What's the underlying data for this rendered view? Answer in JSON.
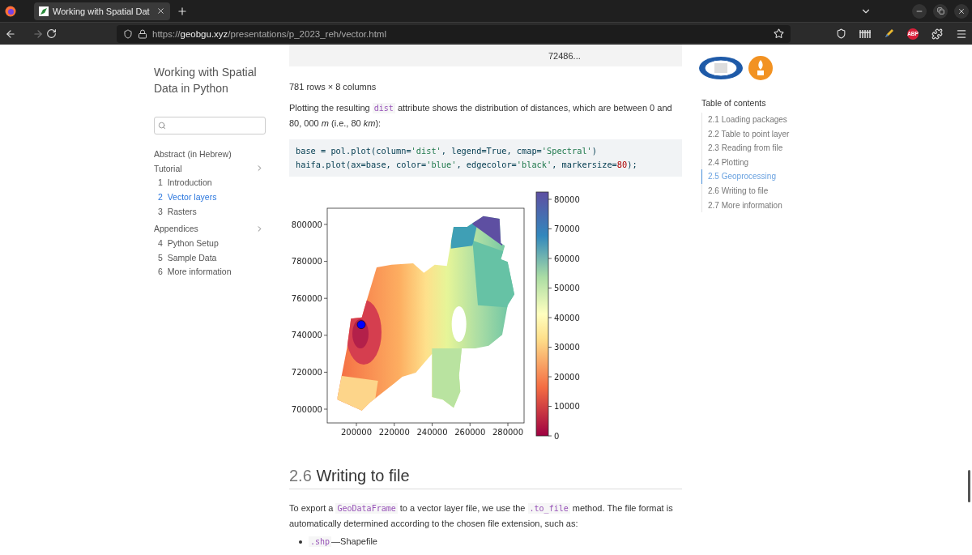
{
  "browser": {
    "tab_title": "Working with Spatial Dat",
    "url_scheme": "https://",
    "url_host": "geobgu.xyz",
    "url_path": "/presentations/p_2023_reh/vector.html",
    "extension_badge": "ABP"
  },
  "sidebar": {
    "title": "Working with Spatial Data in Python",
    "items": [
      {
        "kind": "link",
        "label": "Abstract (in Hebrew)"
      },
      {
        "kind": "section",
        "label": "Tutorial",
        "children": [
          {
            "number": "1",
            "label": "Introduction",
            "selected": false
          },
          {
            "number": "2",
            "label": "Vector layers",
            "selected": true
          },
          {
            "number": "3",
            "label": "Rasters",
            "selected": false
          }
        ]
      },
      {
        "kind": "section",
        "label": "Appendices",
        "children": [
          {
            "number": "4",
            "label": "Python Setup",
            "selected": false
          },
          {
            "number": "5",
            "label": "Sample Data",
            "selected": false
          },
          {
            "number": "6",
            "label": "More information",
            "selected": false
          }
        ]
      }
    ]
  },
  "main": {
    "table_tail": "72486...",
    "table_shape": "781 rows × 8 columns",
    "paragraph": [
      {
        "kind": "text",
        "text": "Plotting the resulting "
      },
      {
        "kind": "code",
        "text": "dist"
      },
      {
        "kind": "text",
        "text": " attribute shows the distribution of distances, which are between 0 and 80, 000 *m* (i.e., 80 *km*):"
      }
    ],
    "code_lines": [
      [
        {
          "kind": "plain",
          "text": "base = pol.plot(column="
        },
        {
          "kind": "string",
          "text": "'dist'"
        },
        {
          "kind": "plain",
          "text": ", legend=True, cmap="
        },
        {
          "kind": "string",
          "text": "'Spectral'"
        },
        {
          "kind": "plain",
          "text": ")"
        }
      ],
      [
        {
          "kind": "plain",
          "text": "haifa.plot(ax=base, color="
        },
        {
          "kind": "string",
          "text": "'blue'"
        },
        {
          "kind": "plain",
          "text": ", edgecolor="
        },
        {
          "kind": "string",
          "text": "'black'"
        },
        {
          "kind": "plain",
          "text": ", markersize="
        },
        {
          "kind": "number",
          "text": "80"
        },
        {
          "kind": "plain",
          "text": ");"
        }
      ]
    ],
    "figure": {
      "yticks": [
        "800000",
        "780000",
        "760000",
        "740000",
        "720000",
        "700000"
      ],
      "xticks": [
        "200000",
        "220000",
        "240000",
        "260000",
        "280000"
      ],
      "colorbar_ticks": [
        "80000",
        "70000",
        "60000",
        "50000",
        "40000",
        "30000",
        "20000",
        "10000",
        "0"
      ]
    },
    "heading": {
      "number": "2.6",
      "title": "Writing to file"
    },
    "paragraph2": [
      {
        "kind": "text",
        "text": "To export a "
      },
      {
        "kind": "code",
        "text": "GeoDataFrame"
      },
      {
        "kind": "text",
        "text": " to a vector layer file, we use the "
      },
      {
        "kind": "code",
        "text": ".to_file"
      },
      {
        "kind": "text",
        "text": " method. The file format is automatically determined according to the chosen file extension, such as:"
      }
    ],
    "list": [
      {
        "code": ".shp",
        "text": "—Shapefile"
      }
    ]
  },
  "toc": {
    "title": "Table of contents",
    "items": [
      {
        "label": "2.1 Loading packages",
        "selected": false
      },
      {
        "label": "2.2 Table to point layer",
        "selected": false
      },
      {
        "label": "2.3 Reading from file",
        "selected": false
      },
      {
        "label": "2.4 Plotting",
        "selected": false
      },
      {
        "label": "2.5 Geoprocessing",
        "selected": true
      },
      {
        "label": "2.6 Writing to file",
        "selected": false
      },
      {
        "label": "2.7 More information",
        "selected": false
      }
    ]
  }
}
